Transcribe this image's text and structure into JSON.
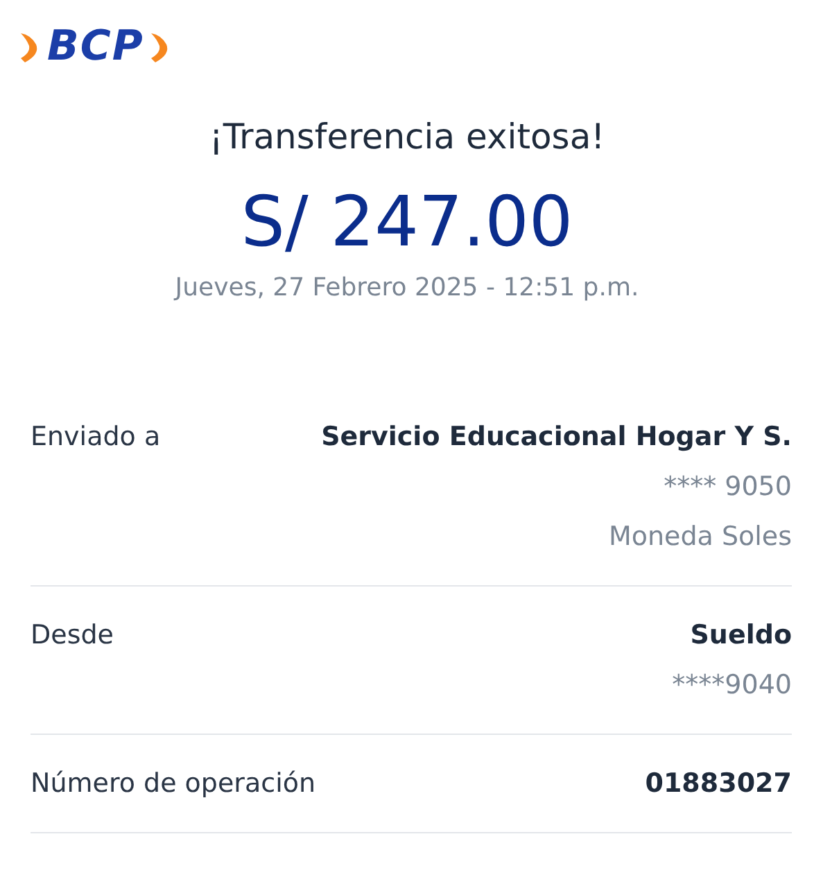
{
  "logo": {
    "text": "BCP"
  },
  "title": "¡Transferencia exitosa!",
  "amount": "S/ 247.00",
  "date": "Jueves, 27 Febrero 2025 - 12:51 p.m.",
  "details": [
    {
      "label": "Enviado a",
      "values": [
        {
          "kind": "primary",
          "text": "Servicio Educacional Hogar Y S."
        },
        {
          "kind": "secondary",
          "text": "**** 9050"
        },
        {
          "kind": "secondary",
          "text": "Moneda Soles"
        }
      ]
    },
    {
      "label": "Desde",
      "values": [
        {
          "kind": "primary",
          "text": "Sueldo"
        },
        {
          "kind": "secondary",
          "text": "****9040"
        }
      ]
    },
    {
      "label": "Número de operación",
      "values": [
        {
          "kind": "primary",
          "text": "01883027"
        }
      ]
    }
  ]
}
